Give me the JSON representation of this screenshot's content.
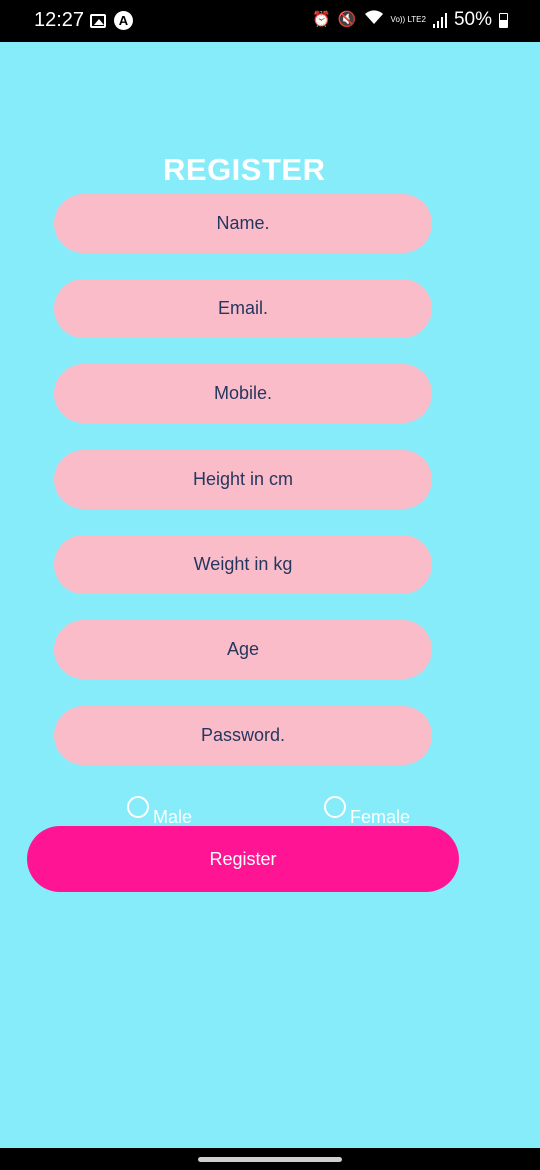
{
  "status_bar": {
    "time": "12:27",
    "network_label": "Vo)) LTE2",
    "battery": "50%",
    "icons": [
      "gallery-icon",
      "app-a-icon",
      "alarm-icon",
      "mute-icon",
      "wifi-icon",
      "signal-icon",
      "battery-icon"
    ]
  },
  "form": {
    "title": "REGISTER",
    "fields": [
      {
        "placeholder": "Name."
      },
      {
        "placeholder": "Email."
      },
      {
        "placeholder": "Mobile."
      },
      {
        "placeholder": "Height in cm"
      },
      {
        "placeholder": "Weight in kg"
      },
      {
        "placeholder": "Age"
      },
      {
        "placeholder": "Password."
      }
    ],
    "gender": {
      "options": [
        "Male",
        "Female"
      ]
    },
    "submit_label": "Register"
  },
  "colors": {
    "background": "#86ecfa",
    "field": "#fbbcca",
    "field_text": "#25375e",
    "button": "#ff1493",
    "title": "#ffffff"
  }
}
